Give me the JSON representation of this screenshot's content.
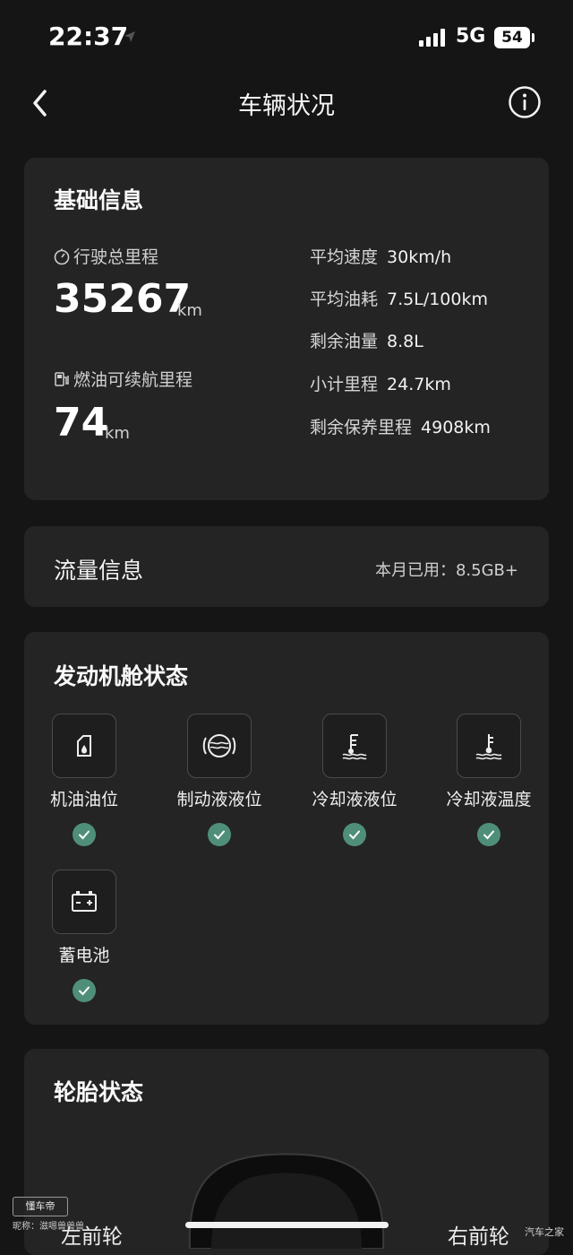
{
  "status_bar": {
    "time": "22:37",
    "network": "5G",
    "battery": "54"
  },
  "nav": {
    "title": "车辆状况",
    "back_icon": "chevron-left-icon",
    "info_icon": "info-icon"
  },
  "basic": {
    "title": "基础信息",
    "total_mileage_label": "行驶总里程",
    "total_mileage_value": "35267",
    "total_mileage_unit": "km",
    "range_label": "燃油可续航里程",
    "range_value": "74",
    "range_unit": "km",
    "stats": [
      {
        "label": "平均速度",
        "value": "30km/h"
      },
      {
        "label": "平均油耗",
        "value": "7.5L/100km"
      },
      {
        "label": "剩余油量",
        "value": "8.8L"
      },
      {
        "label": "小计里程",
        "value": "24.7km"
      },
      {
        "label": "剩余保养里程",
        "value": "4908km"
      }
    ]
  },
  "flow": {
    "title": "流量信息",
    "used": "本月已用：8.5GB+"
  },
  "engine": {
    "title": "发动机舱状态",
    "items": [
      {
        "label": "机油油位",
        "icon": "oil-can-icon",
        "status": "ok"
      },
      {
        "label": "制动液液位",
        "icon": "brake-fluid-icon",
        "status": "ok"
      },
      {
        "label": "冷却液液位",
        "icon": "coolant-level-icon",
        "status": "ok"
      },
      {
        "label": "冷却液温度",
        "icon": "coolant-temp-icon",
        "status": "ok"
      },
      {
        "label": "蓄电池",
        "icon": "battery-icon",
        "status": "ok"
      }
    ],
    "ok_color": "#4f8f7a"
  },
  "tire": {
    "title": "轮胎状态",
    "front_left": "左前轮",
    "front_right": "右前轮"
  },
  "watermark": {
    "left_logo": "懂车帝",
    "left_sub": "昵称：滋嗯兽兽兽",
    "right": "汽车之家"
  }
}
